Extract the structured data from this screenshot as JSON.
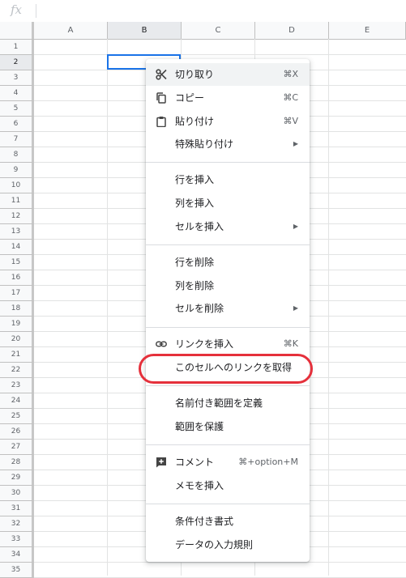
{
  "formula_bar": {
    "label": "fx",
    "value": ""
  },
  "columns": [
    {
      "label": "A",
      "active": false
    },
    {
      "label": "B",
      "active": true
    },
    {
      "label": "C",
      "active": false
    },
    {
      "label": "D",
      "active": false
    },
    {
      "label": "E",
      "active": false
    }
  ],
  "rows": [
    "1",
    "2",
    "3",
    "4",
    "5",
    "6",
    "7",
    "8",
    "9",
    "10",
    "11",
    "12",
    "13",
    "14",
    "15",
    "16",
    "17",
    "18",
    "19",
    "20",
    "21",
    "22",
    "23",
    "24",
    "25",
    "26",
    "27",
    "28",
    "29",
    "30",
    "31",
    "32",
    "33",
    "34",
    "35"
  ],
  "active_row": "2",
  "menu": {
    "cut": {
      "label": "切り取り",
      "shortcut": "⌘X",
      "icon": "scissors-icon"
    },
    "copy": {
      "label": "コピー",
      "shortcut": "⌘C",
      "icon": "copy-icon"
    },
    "paste": {
      "label": "貼り付け",
      "shortcut": "⌘V",
      "icon": "clipboard-icon"
    },
    "paste_special": {
      "label": "特殊貼り付け",
      "submenu": "▶"
    },
    "insert_row": {
      "label": "行を挿入"
    },
    "insert_column": {
      "label": "列を挿入"
    },
    "insert_cells": {
      "label": "セルを挿入",
      "submenu": "▶"
    },
    "delete_row": {
      "label": "行を削除"
    },
    "delete_column": {
      "label": "列を削除"
    },
    "delete_cells": {
      "label": "セルを削除",
      "submenu": "▶"
    },
    "insert_link": {
      "label": "リンクを挿入",
      "shortcut": "⌘K",
      "icon": "link-icon"
    },
    "get_cell_link": {
      "label": "このセルへのリンクを取得"
    },
    "define_named_range": {
      "label": "名前付き範囲を定義"
    },
    "protect_range": {
      "label": "範囲を保護"
    },
    "comment": {
      "label": "コメント",
      "shortcut": "⌘+option+M",
      "icon": "add-comment-icon"
    },
    "insert_note": {
      "label": "メモを挿入"
    },
    "conditional_formatting": {
      "label": "条件付き書式"
    },
    "data_validation": {
      "label": "データの入力規則"
    }
  },
  "colors": {
    "selection": "#1a73e8",
    "highlight_ring": "#e5303b"
  }
}
